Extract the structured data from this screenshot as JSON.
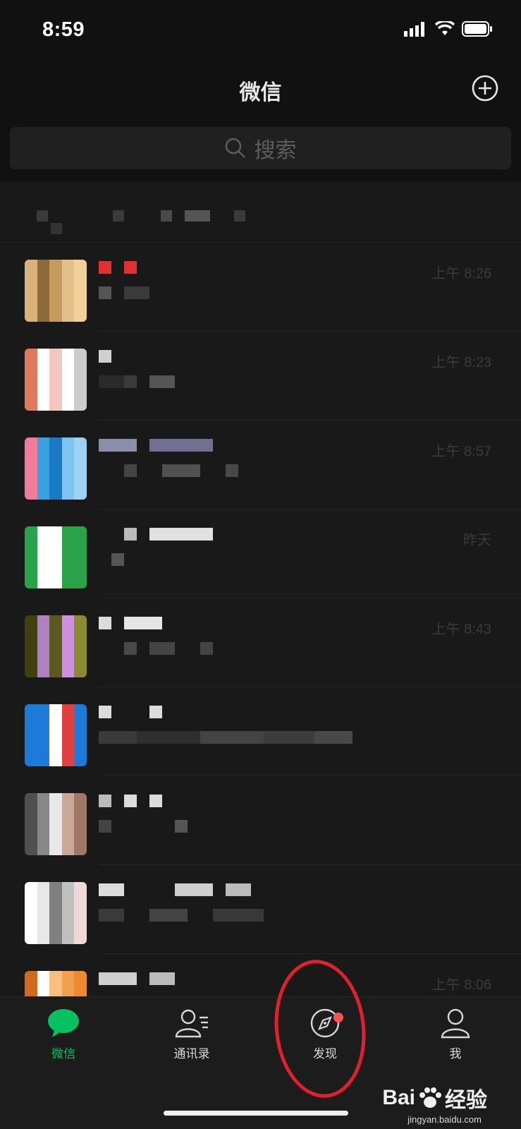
{
  "status_bar": {
    "time": "8:59"
  },
  "nav": {
    "title": "微信"
  },
  "search": {
    "placeholder": "搜索"
  },
  "chats": [
    {
      "time": "上午 8:26",
      "avatar_colors": [
        "#d9b27a",
        "#c49a5e",
        "#f2d09a",
        "#8c6a3a",
        "#e2c08a"
      ]
    },
    {
      "time": "上午 8:23",
      "avatar_colors": [
        "#ffffff",
        "#e07a5f",
        "#f4c6c0",
        "#cccccc",
        "#ffffff"
      ]
    },
    {
      "time": "上午 8:57",
      "avatar_colors": [
        "#3aa0e0",
        "#7fc4f0",
        "#f27a9a",
        "#1a7bc4",
        "#9fd2f2"
      ]
    },
    {
      "time": "昨天",
      "avatar_colors": [
        "#2aa24a",
        "#ffffff",
        "#2aa24a",
        "#2aa24a",
        "#ffffff"
      ]
    },
    {
      "time": "上午 8:43",
      "avatar_colors": [
        "#5a5a20",
        "#8a8a30",
        "#b080c0",
        "#d090e0",
        "#404010"
      ]
    },
    {
      "time": "",
      "avatar_colors": [
        "#1e7ad8",
        "#ffffff",
        "#1e7ad8",
        "#1e7ad8",
        "#e04040"
      ]
    },
    {
      "time": "",
      "avatar_colors": [
        "#c8a898",
        "#505050",
        "#e8e8e8",
        "#a07868",
        "#888888"
      ]
    },
    {
      "time": "",
      "avatar_colors": [
        "#e8e8e8",
        "#c0c0c0",
        "#ffffff",
        "#808080",
        "#f0d8d8"
      ]
    },
    {
      "time": "上午 8:06",
      "avatar_colors": [
        "#f08a30",
        "#ffffff",
        "#f0a050",
        "#d06a20",
        "#f8c080"
      ]
    }
  ],
  "tabs": [
    {
      "label": "微信",
      "icon": "chat-icon",
      "active": true
    },
    {
      "label": "通讯录",
      "icon": "contacts-icon",
      "active": false
    },
    {
      "label": "发现",
      "icon": "compass-icon",
      "active": false
    },
    {
      "label": "我",
      "icon": "person-icon",
      "active": false
    }
  ],
  "colors": {
    "accent": "#07c160",
    "badge": "#fa5151",
    "highlight": "#e0202f",
    "background": "#111111"
  },
  "watermark": {
    "brand": "Bai",
    "brand_suffix": "经验",
    "url": "jingyan.baidu.com"
  }
}
